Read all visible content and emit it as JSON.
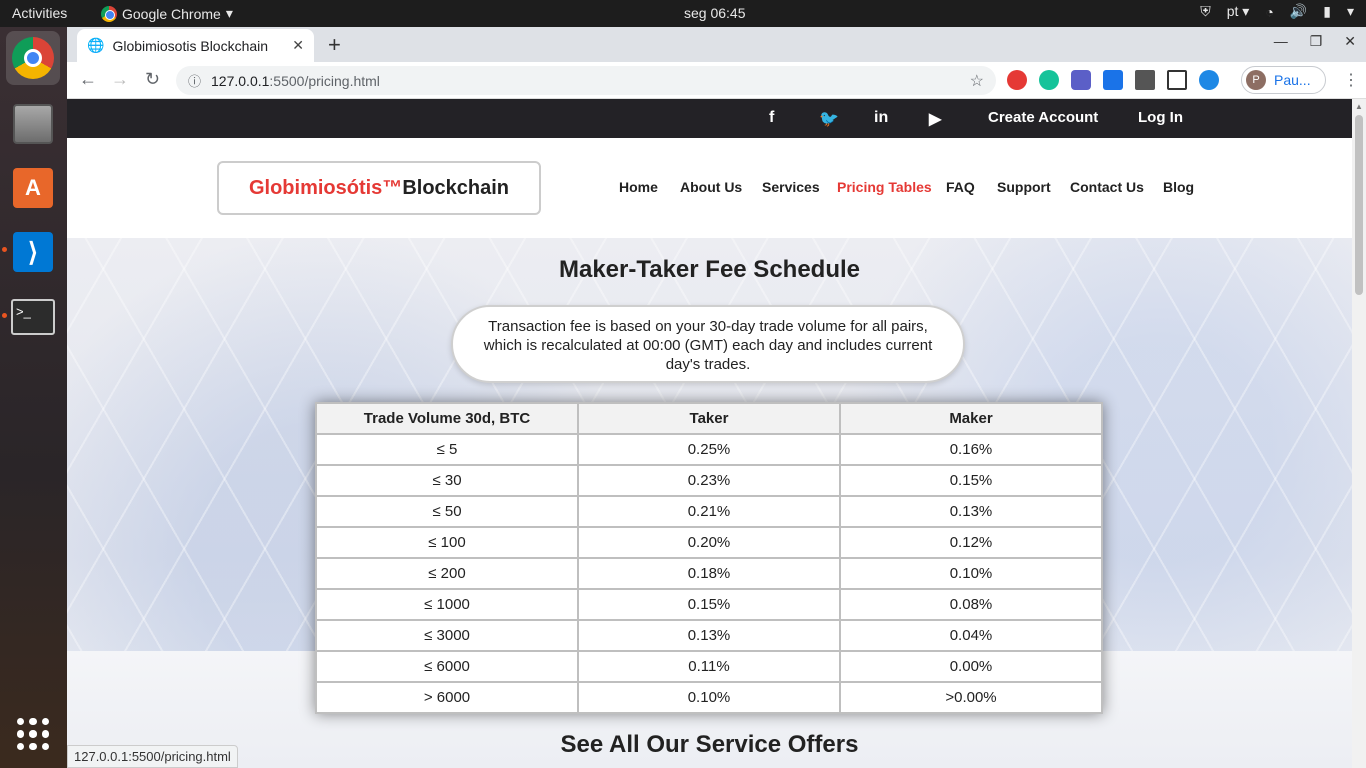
{
  "system_bar": {
    "activities": "Activities",
    "app_name": "Google Chrome",
    "clock": "seg 06:45",
    "language": "pt"
  },
  "browser": {
    "tab_title": "Globimiosotis Blockchain",
    "url_host": "127.0.0.1",
    "url_path": ":5500/pricing.html",
    "profile_initial": "P",
    "profile_name": "Pau..."
  },
  "site": {
    "top_links": {
      "create_account": "Create Account",
      "log_in": "Log In"
    },
    "social": [
      "f",
      "t",
      "in",
      "yt"
    ],
    "logo": {
      "red_part": "Globimiosótis™",
      "dark_part": "Blockchain"
    },
    "nav": [
      "Home",
      "About Us",
      "Services",
      "Pricing Tables",
      "FAQ",
      "Support",
      "Contact Us",
      "Blog"
    ],
    "active_nav": "Pricing Tables"
  },
  "main": {
    "title": "Maker-Taker Fee Schedule",
    "note": "Transaction fee is based on your 30-day trade volume for all pairs, which is recalculated at 00:00 (GMT) each day and includes current day's trades.",
    "table": {
      "headers": [
        "Trade Volume 30d, BTC",
        "Taker",
        "Maker"
      ],
      "rows": [
        [
          "≤ 5",
          "0.25%",
          "0.16%"
        ],
        [
          "≤ 30",
          "0.23%",
          "0.15%"
        ],
        [
          "≤ 50",
          "0.21%",
          "0.13%"
        ],
        [
          "≤ 100",
          "0.20%",
          "0.12%"
        ],
        [
          "≤ 200",
          "0.18%",
          "0.10%"
        ],
        [
          "≤ 1000",
          "0.15%",
          "0.08%"
        ],
        [
          "≤ 3000",
          "0.13%",
          "0.04%"
        ],
        [
          "≤ 6000",
          "0.11%",
          "0.00%"
        ],
        [
          "> 6000",
          "0.10%",
          ">0.00%"
        ]
      ]
    },
    "next_section_title": "See All Our Service Offers"
  },
  "status_url": "127.0.0.1:5500/pricing.html"
}
